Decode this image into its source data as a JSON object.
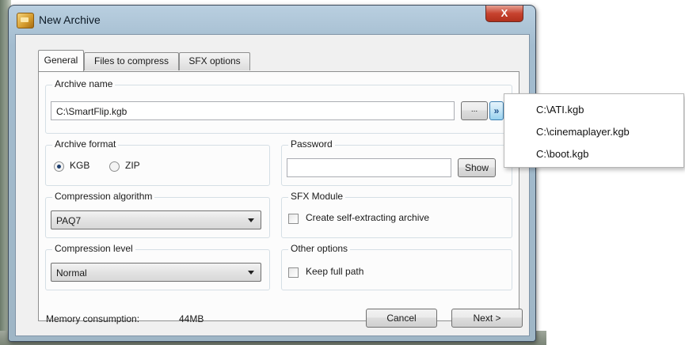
{
  "window": {
    "title": "New Archive",
    "close_glyph": "X"
  },
  "tabs": [
    {
      "label": "General",
      "active": true
    },
    {
      "label": "Files to compress",
      "active": false
    },
    {
      "label": "SFX options",
      "active": false
    }
  ],
  "archive_name": {
    "group_label": "Archive name",
    "value": "C:\\SmartFlip.kgb",
    "browse_label": "...",
    "history_glyph": "»"
  },
  "archive_format": {
    "group_label": "Archive format",
    "options": [
      {
        "label": "KGB",
        "selected": true
      },
      {
        "label": "ZIP",
        "selected": false
      }
    ]
  },
  "password": {
    "group_label": "Password",
    "value": "",
    "show_label": "Show"
  },
  "compression_algorithm": {
    "group_label": "Compression algorithm",
    "selected": "PAQ7"
  },
  "sfx_module": {
    "group_label": "SFX Module",
    "checkbox_label": "Create self-extracting archive",
    "checked": false
  },
  "compression_level": {
    "group_label": "Compression level",
    "selected": "Normal"
  },
  "other_options": {
    "group_label": "Other options",
    "checkbox_label": "Keep full path",
    "checked": false
  },
  "footer": {
    "memory_label": "Memory consumption:",
    "memory_value": "44MB",
    "cancel_label": "Cancel",
    "next_label": "Next >"
  },
  "history_dropdown": {
    "items": [
      "C:\\ATI.kgb",
      "C:\\cinemaplayer.kgb",
      "C:\\boot.kgb"
    ]
  },
  "colors": {
    "frame": "#a3bccf",
    "close_button": "#c7432f",
    "panel": "#fcfcfc",
    "accent_button": "#98d1ef"
  }
}
